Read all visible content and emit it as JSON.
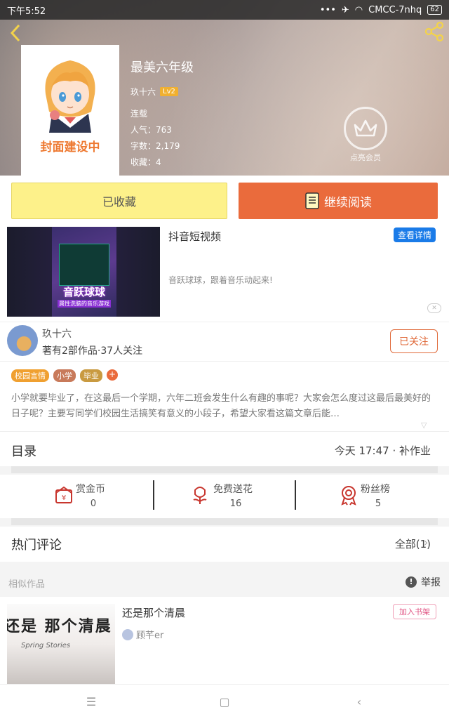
{
  "status_bar": {
    "time": "下午5:52",
    "signal_dots": "•••",
    "network": "CMCC-7nhq",
    "battery": "62"
  },
  "book": {
    "title": "最美六年级",
    "author": "玖十六",
    "level": "Lv2",
    "status": "连载",
    "popularity": "人气：763",
    "word_count": "字数：2,179",
    "favorites": "收藏：4",
    "cover_text": "封面建设中",
    "member_label": "点亮会员"
  },
  "actions": {
    "collected_label": "已收藏",
    "continue_label": "继续阅读"
  },
  "ad": {
    "title": "抖音短视频",
    "description": "音跃球球，跟着音乐动起来!",
    "detail_button": "查看详情",
    "game_logo": "音跃球球",
    "game_sub": "属性洗脑的音乐游戏",
    "close": "✕"
  },
  "author": {
    "name": "玖十六",
    "stats": "著有2部作品·37人关注",
    "follow_label": "已关注"
  },
  "tags": [
    {
      "label": "校园言情",
      "color": "#f0a030"
    },
    {
      "label": "小学",
      "color": "#c87a5a"
    },
    {
      "label": "毕业",
      "color": "#c99a40"
    }
  ],
  "tag_plus": "+",
  "summary": "小学就要毕业了，在这最后一个学期，六年二班会发生什么有趣的事呢？大家会怎么度过这最后最美好的日子呢？主要写同学们校园生活搞笑有意义的小段子，希望大家看这篇文章后能…",
  "toc": {
    "title": "目录",
    "latest": "今天 17:47 · 补作业"
  },
  "rewards": [
    {
      "label": "赏金币",
      "value": "0",
      "icon": "gold-coin-icon"
    },
    {
      "label": "免费送花",
      "value": "16",
      "icon": "flower-icon"
    },
    {
      "label": "粉丝榜",
      "value": "5",
      "icon": "medal-icon"
    }
  ],
  "comments": {
    "title": "热门评论",
    "all_label": "全部(1)"
  },
  "similar": {
    "header": "相似作品",
    "report_label": "举报",
    "item": {
      "title": "还是那个清晨",
      "author": "顾芊er",
      "add_label": "加入书架",
      "cover_title": "还是  那个清晨",
      "cover_sub": "Spring Stories"
    }
  },
  "colors": {
    "accent_orange": "#ea6b3c",
    "collected_yellow": "#fdf18a",
    "detail_blue": "#1a7be8"
  }
}
